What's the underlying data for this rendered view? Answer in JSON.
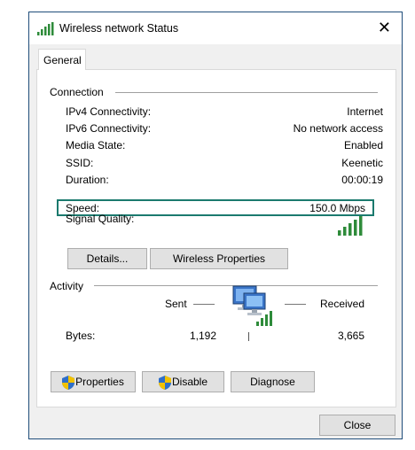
{
  "window": {
    "title": "Wireless network Status",
    "close_glyph": "✕",
    "tab_label": "General"
  },
  "connection": {
    "group_label": "Connection",
    "rows": [
      {
        "label": "IPv4 Connectivity:",
        "value": "Internet"
      },
      {
        "label": "IPv6 Connectivity:",
        "value": "No network access"
      },
      {
        "label": "Media State:",
        "value": "Enabled"
      },
      {
        "label": "SSID:",
        "value": "Keenetic"
      },
      {
        "label": "Duration:",
        "value": "00:00:19"
      }
    ],
    "speed": {
      "label": "Speed:",
      "value": "150.0 Mbps"
    },
    "signal_label": "Signal Quality:",
    "signal_bars_filled": 5,
    "signal_bars_total": 5,
    "details_button": "Details...",
    "wireless_properties_button": "Wireless Properties"
  },
  "activity": {
    "group_label": "Activity",
    "sent_label": "Sent",
    "received_label": "Received",
    "bytes_label": "Bytes:",
    "bytes_sent": "1,192",
    "bytes_received": "3,665"
  },
  "buttons": {
    "properties": "Properties",
    "disable": "Disable",
    "diagnose": "Diagnose",
    "close": "Close"
  },
  "colors": {
    "signal_green": "#2e8b3a",
    "speed_highlight": "#1b7a6e",
    "shield_blue": "#2f6fc9",
    "shield_yellow": "#f2c200"
  }
}
